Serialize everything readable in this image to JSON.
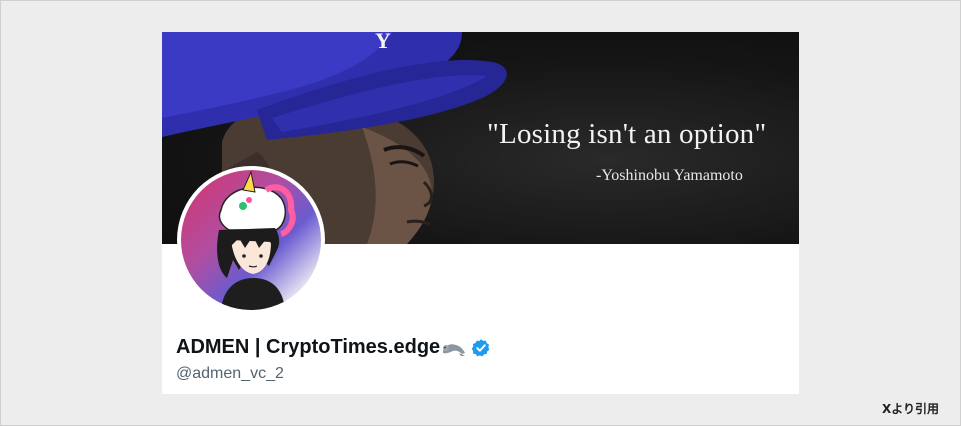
{
  "profile": {
    "display_name": "ADMEN | CryptoTimes.edge",
    "name_emoji": "seal-icon",
    "verified": true,
    "handle": "@admen_vc_2"
  },
  "banner": {
    "quote": "\"Losing isn't an option\"",
    "quote_author": "-Yoshinobu Yamamoto"
  },
  "source": {
    "label": "Xより引用"
  },
  "colors": {
    "verified_blue": "#1d9bf0",
    "cap_blue": "#2f2fae",
    "handle_gray": "#536471",
    "name_black": "#0f1419"
  }
}
